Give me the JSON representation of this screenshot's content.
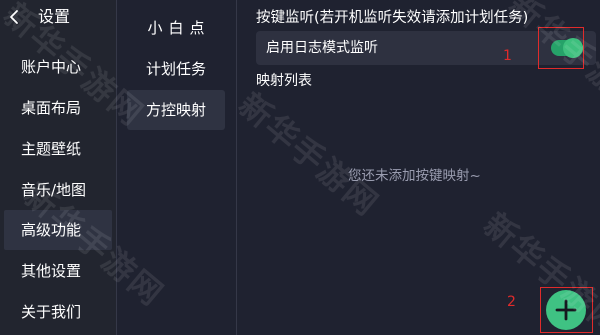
{
  "header": {
    "title": "设置"
  },
  "sidebar": {
    "items": [
      {
        "label": "账户中心"
      },
      {
        "label": "桌面布局"
      },
      {
        "label": "主题壁纸"
      },
      {
        "label": "音乐/地图"
      },
      {
        "label": "高级功能"
      },
      {
        "label": "其他设置"
      },
      {
        "label": "关于我们"
      }
    ],
    "active_index": 4
  },
  "subnav": {
    "items": [
      {
        "label": "小白点"
      },
      {
        "label": "计划任务"
      },
      {
        "label": "方控映射"
      }
    ],
    "active_index": 2
  },
  "main": {
    "section_title": "按键监听(若开机监听失效请添加计划任务)",
    "log_mode_label": "启用日志模式监听",
    "log_mode_enabled": true,
    "list_title": "映射列表",
    "empty_message": "您还未添加按键映射~"
  },
  "annotations": {
    "marker_1": "1",
    "marker_2": "2",
    "color": "#e02b2b"
  },
  "watermark": {
    "text": "新华手游网"
  },
  "colors": {
    "background": "#1f2230",
    "active_item": "#2f3342",
    "accent_green": "#3fc283"
  },
  "icons": {
    "back": "chevron-left-icon",
    "add": "plus-icon"
  }
}
